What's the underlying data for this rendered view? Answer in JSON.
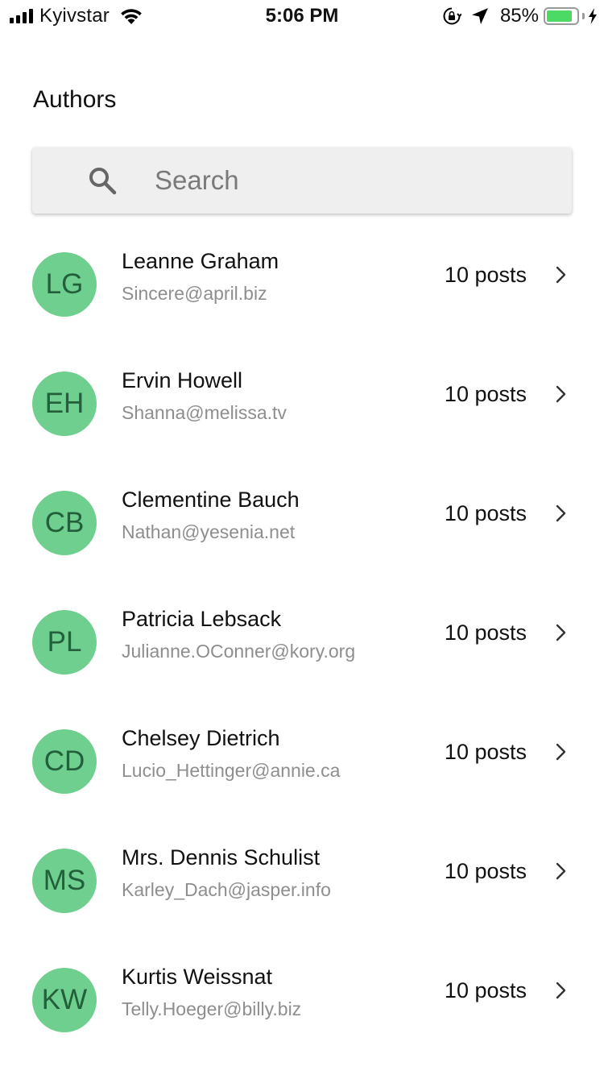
{
  "status_bar": {
    "carrier": "Kyivstar",
    "time": "5:06 PM",
    "battery_percent": "85%",
    "battery_level": 0.85,
    "icons": [
      "signal-icon",
      "wifi-icon",
      "orientation-lock-icon",
      "location-arrow-icon",
      "battery-icon",
      "charging-bolt-icon"
    ]
  },
  "page": {
    "title": "Authors"
  },
  "search": {
    "placeholder": "Search",
    "value": "",
    "icon": "search-icon"
  },
  "colors": {
    "avatar_bg": "#6fcf8f",
    "avatar_text": "#225f3a",
    "email_text": "#8e8e8e",
    "search_bg": "#efefef",
    "battery_green": "#4cd964"
  },
  "authors": [
    {
      "initials": "LG",
      "name": "Leanne Graham",
      "email": "Sincere@april.biz",
      "posts": "10 posts"
    },
    {
      "initials": "EH",
      "name": "Ervin Howell",
      "email": "Shanna@melissa.tv",
      "posts": "10 posts"
    },
    {
      "initials": "CB",
      "name": "Clementine Bauch",
      "email": "Nathan@yesenia.net",
      "posts": "10 posts"
    },
    {
      "initials": "PL",
      "name": "Patricia Lebsack",
      "email": "Julianne.OConner@kory.org",
      "posts": "10 posts"
    },
    {
      "initials": "CD",
      "name": "Chelsey Dietrich",
      "email": "Lucio_Hettinger@annie.ca",
      "posts": "10 posts"
    },
    {
      "initials": "MS",
      "name": "Mrs. Dennis Schulist",
      "email": "Karley_Dach@jasper.info",
      "posts": "10 posts"
    },
    {
      "initials": "KW",
      "name": "Kurtis Weissnat",
      "email": "Telly.Hoeger@billy.biz",
      "posts": "10 posts"
    }
  ]
}
